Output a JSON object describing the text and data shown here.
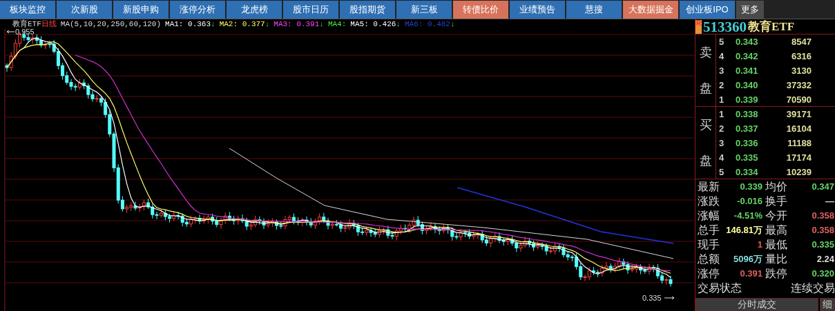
{
  "nav_tabs": [
    {
      "label": "板块监控",
      "kind": "normal"
    },
    {
      "label": "次新股",
      "kind": "normal"
    },
    {
      "label": "新股申购",
      "kind": "normal"
    },
    {
      "label": "涨停分析",
      "kind": "normal"
    },
    {
      "label": "龙虎榜",
      "kind": "normal"
    },
    {
      "label": "股市日历",
      "kind": "normal"
    },
    {
      "label": "股指期货",
      "kind": "normal"
    },
    {
      "label": "新三板",
      "kind": "normal"
    },
    {
      "label": "转债比价",
      "kind": "highlight"
    },
    {
      "label": "业绩预告",
      "kind": "normal"
    },
    {
      "label": "慧搜",
      "kind": "normal"
    },
    {
      "label": "大数据掘金",
      "kind": "highlight"
    },
    {
      "label": "创业板IPO",
      "kind": "normal"
    },
    {
      "label": "更多",
      "kind": "more"
    }
  ],
  "chart": {
    "name": "教育ETF",
    "period": "日线",
    "ma_label": "MA(5,10,20,250,60,120)",
    "indicators": [
      {
        "name": "MA1:",
        "value": "0.363",
        "arrow": "↓",
        "color": "#ffffff"
      },
      {
        "name": "MA2:",
        "value": "0.377",
        "arrow": "↓",
        "color": "#ffff66"
      },
      {
        "name": "MA3:",
        "value": "0.391",
        "arrow": "↓",
        "color": "#ff44ff"
      },
      {
        "name": "MA4:",
        "color": "#44ee44"
      },
      {
        "name": "MA5:",
        "value": "0.426",
        "arrow": "↓",
        "color": "#ffffff"
      },
      {
        "name": "MA6:",
        "value": "0.462",
        "arrow": "↓",
        "color": "#2a3fd8"
      }
    ],
    "high_marker": "0.955",
    "low_marker": "0.335"
  },
  "quote": {
    "badge": "R",
    "code": "513360",
    "name": "教育ETF",
    "sell_labels": [
      "卖",
      "盘"
    ],
    "sell": [
      {
        "level": "5",
        "price": "0.343",
        "volume": "8547"
      },
      {
        "level": "4",
        "price": "0.342",
        "volume": "6316"
      },
      {
        "level": "3",
        "price": "0.341",
        "volume": "3130"
      },
      {
        "level": "2",
        "price": "0.340",
        "volume": "37332"
      },
      {
        "level": "1",
        "price": "0.339",
        "volume": "70590"
      }
    ],
    "buy_labels": [
      "买",
      "盘"
    ],
    "buy": [
      {
        "level": "1",
        "price": "0.338",
        "volume": "39171"
      },
      {
        "level": "2",
        "price": "0.337",
        "volume": "16104"
      },
      {
        "level": "3",
        "price": "0.336",
        "volume": "11188"
      },
      {
        "level": "4",
        "price": "0.335",
        "volume": "17174"
      },
      {
        "level": "5",
        "price": "0.334",
        "volume": "10239"
      }
    ],
    "stats": [
      {
        "cells": [
          {
            "label": "最新",
            "value": "0.339",
            "color": "#66d466"
          },
          {
            "label": "均价",
            "value": "0.347",
            "color": "#66d466"
          }
        ]
      },
      {
        "cells": [
          {
            "label": "涨跌",
            "value": "-0.016",
            "color": "#66d466"
          },
          {
            "label": "换手",
            "value": "—",
            "color": "#dddddd"
          }
        ]
      },
      {
        "cells": [
          {
            "label": "涨幅",
            "value": "-4.51%",
            "color": "#66d466"
          },
          {
            "label": "今开",
            "value": "0.358",
            "color": "#e06060"
          }
        ]
      },
      {
        "cells": [
          {
            "label": "总手",
            "value": "146.81万",
            "color": "#ffffa0"
          },
          {
            "label": "最高",
            "value": "0.358",
            "color": "#e06060"
          }
        ]
      },
      {
        "cells": [
          {
            "label": "现手",
            "value": "1",
            "color": "#e06060"
          },
          {
            "label": "最低",
            "value": "0.335",
            "color": "#66d466"
          }
        ]
      },
      {
        "cells": [
          {
            "label": "总额",
            "value": "5096万",
            "color": "#88dddd"
          },
          {
            "label": "量比",
            "value": "2.24",
            "color": "#dddddd"
          }
        ]
      },
      {
        "cells": [
          {
            "label": "涨停",
            "value": "0.391",
            "color": "#e06060"
          },
          {
            "label": "跌停",
            "value": "0.320",
            "color": "#66d466"
          }
        ]
      }
    ],
    "status_label": "交易状态",
    "status_value": "连续交易",
    "bottom_buttons": [
      "分时成交",
      "细"
    ]
  }
}
